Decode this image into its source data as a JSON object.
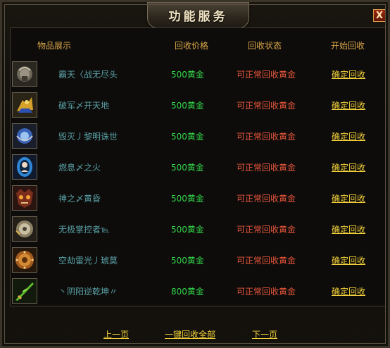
{
  "window": {
    "title": "功能服务",
    "close_label": "X"
  },
  "table": {
    "headers": [
      "物品展示",
      "回收价格",
      "回收状态",
      "开始回收"
    ],
    "rows": [
      {
        "name": "霸天〈战无尽头",
        "price": "500黄金",
        "status": "可正常回收黄金",
        "action": "确定回收",
        "icon": "armor-chest-icon"
      },
      {
        "name": "破军〆开天地",
        "price": "500黄金",
        "status": "可正常回收黄金",
        "action": "确定回收",
        "icon": "golden-dragon-icon"
      },
      {
        "name": "毁灭丿黎明诛世",
        "price": "500黄金",
        "status": "可正常回收黄金",
        "action": "确定回收",
        "icon": "blue-orb-icon"
      },
      {
        "name": "燃息〆之火",
        "price": "500黄金",
        "status": "可正常回收黄金",
        "action": "确定回收",
        "icon": "portrait-icon"
      },
      {
        "name": "神之〆黄昏",
        "price": "500黄金",
        "status": "可正常回收黄金",
        "action": "确定回收",
        "icon": "demon-mask-icon"
      },
      {
        "name": "无极掌控者℡",
        "price": "500黄金",
        "status": "可正常回收黄金",
        "action": "确定回收",
        "icon": "silver-shield-icon"
      },
      {
        "name": "空劫雷光丿琥莫",
        "price": "500黄金",
        "status": "可正常回收黄金",
        "action": "确定回收",
        "icon": "bronze-medallion-icon"
      },
      {
        "name": "丶阴阳逆乾坤〃",
        "price": "800黄金",
        "status": "可正常回收黄金",
        "action": "确定回收",
        "icon": "green-sword-icon"
      }
    ]
  },
  "footer": {
    "prev": "上一页",
    "recycle_all": "一键回收全部",
    "next": "下一页"
  }
}
